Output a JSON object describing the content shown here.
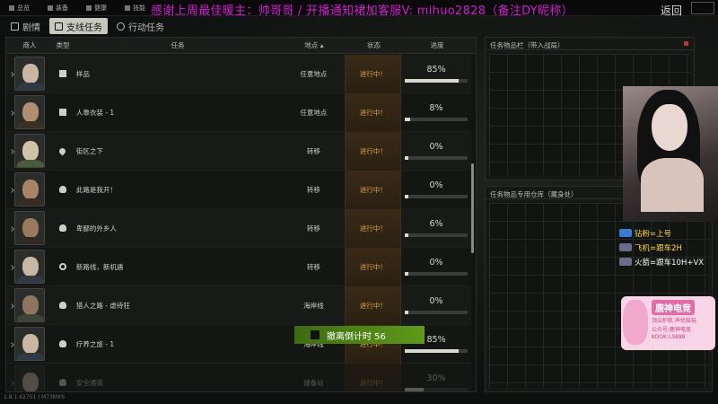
{
  "topbar": {
    "items": [
      "总览",
      "装备",
      "健康",
      "技能"
    ],
    "back": "返回"
  },
  "marquee": "感谢上周最佳暖主：帅哥哥 / 开播通知裙加客服V: mihuo2828（备注DY昵称）",
  "tabs": [
    {
      "label": "剧情",
      "active": false
    },
    {
      "label": "支线任务",
      "active": true
    },
    {
      "label": "行动任务",
      "active": false
    }
  ],
  "table": {
    "headers": {
      "trader": "商人",
      "type": "类型",
      "task": "任务",
      "location": "地点",
      "status": "状态",
      "progress": "进度"
    },
    "rows": [
      {
        "type": "gear",
        "task": "样品",
        "location": "任意地点",
        "status": "进行中！",
        "progress": "85%",
        "fill": 0.85,
        "skin": "#c9b6a3",
        "cloth": "#2e3a45"
      },
      {
        "type": "gear",
        "task": "人靠衣装 - 1",
        "location": "任意地点",
        "status": "进行中！",
        "progress": "8%",
        "fill": 0.08,
        "skin": "#b08e72",
        "cloth": "#3b3022"
      },
      {
        "type": "pin",
        "task": "街区之下",
        "location": "转移",
        "status": "进行中！",
        "progress": "0%",
        "fill": 0.0,
        "skin": "#d3c2a8",
        "cloth": "#4a5a3a"
      },
      {
        "type": "skull",
        "task": "此路是我开！",
        "location": "转移",
        "status": "进行中！",
        "progress": "0%",
        "fill": 0.0,
        "skin": "#a98468",
        "cloth": "#3a2c22"
      },
      {
        "type": "skull",
        "task": "卑鄙的外乡人",
        "location": "转移",
        "status": "进行中！",
        "progress": "6%",
        "fill": 0.06,
        "skin": "#9a7a5e",
        "cloth": "#2f2a22"
      },
      {
        "type": "mag",
        "task": "新路线，新机遇",
        "location": "转移",
        "status": "进行中！",
        "progress": "0%",
        "fill": 0.0,
        "skin": "#c9b6a3",
        "cloth": "#2e3a45"
      },
      {
        "type": "skull",
        "task": "猎人之路 - 虐待狂",
        "location": "海岸线",
        "status": "进行中！",
        "progress": "0%",
        "fill": 0.0,
        "skin": "#8e7560",
        "cloth": "#3d4438"
      },
      {
        "type": "skull",
        "task": "疗养之旅 - 1",
        "location": "海岸线",
        "status": "进行中！",
        "progress": "85%",
        "fill": 0.85,
        "skin": "#c9b6a3",
        "cloth": "#2e3a45"
      },
      {
        "type": "skull",
        "task": "安全通道",
        "location": "储备站",
        "status": "进行中！",
        "progress": "30%",
        "fill": 0.3,
        "skin": "#c9b6a3",
        "cloth": "#2e3a45",
        "faded": true
      }
    ]
  },
  "right": {
    "panel1_title": "任务物品栏（带入战局）",
    "panel2_title": "任务物品专用仓库（藏身处）"
  },
  "overlay": {
    "line1": "钻粉=上号",
    "line2": "飞机=跟车2H",
    "line3": "火箭=跟车10H+VX",
    "promo_title": "鹿神电竞",
    "promo_l1": "顶尖护航 声优陪玩",
    "promo_l2": "公众号:鹿神电竞",
    "promo_l3": "KOOK:LS888"
  },
  "banner": "撤离倒计时 56",
  "version": "1.8.1.42751 | M73MXS"
}
